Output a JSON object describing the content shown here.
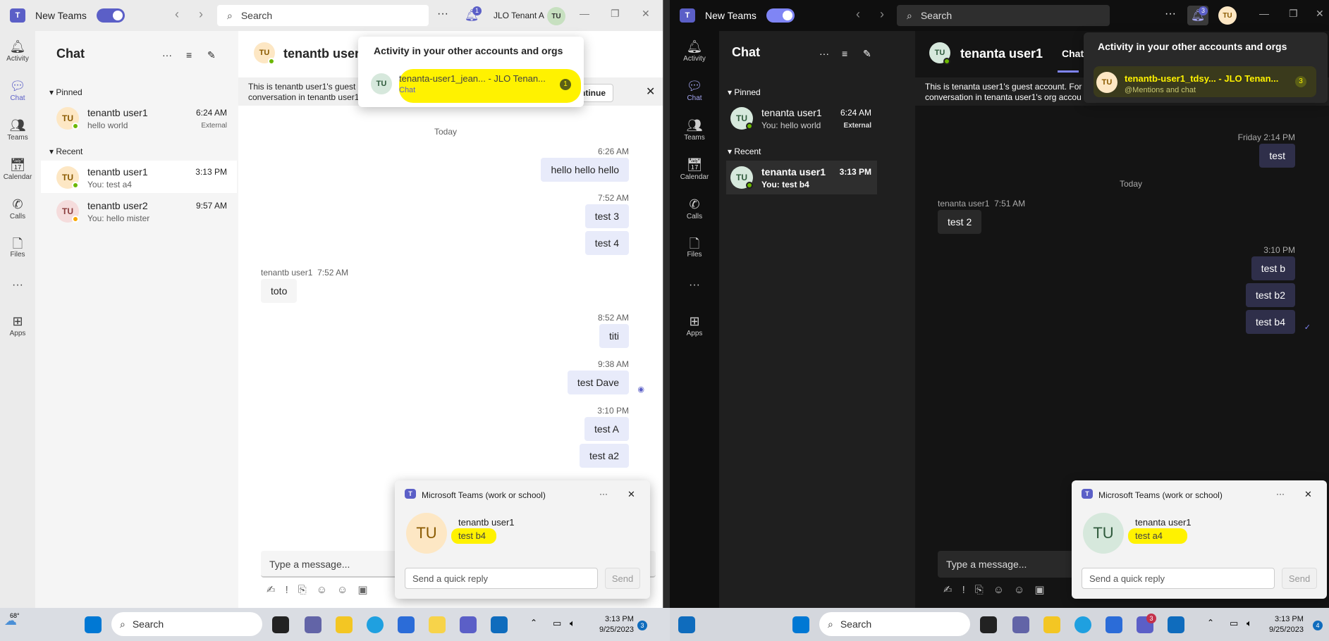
{
  "left": {
    "app_label": "New Teams",
    "search_placeholder": "Search",
    "notif_count": "1",
    "tenant": "JLO Tenant A",
    "avatar": "TU",
    "chat_title": "Chat",
    "pinned_label": "Pinned",
    "recent_label": "Recent",
    "pinned": [
      {
        "initials": "TU",
        "name": "tenantb user1",
        "preview": "hello world",
        "time": "6:24 AM",
        "tag": "External"
      }
    ],
    "recent": [
      {
        "initials": "TU",
        "name": "tenantb user1",
        "preview": "You: test a4",
        "time": "3:13 PM"
      },
      {
        "initials": "TU",
        "name": "tenantb user2",
        "preview": "You: hello mister",
        "time": "9:57 AM"
      }
    ],
    "conv_name": "tenantb user1",
    "banner_line1": "This is tenantb user1's guest",
    "banner_line2": "conversation in tenantb user1",
    "continue_label": "Continue",
    "day": "Today",
    "messages": [
      {
        "time": "6:26 AM",
        "text": "hello hello hello"
      },
      {
        "time": "7:52 AM",
        "text": "test 3"
      },
      {
        "text": "test 4"
      },
      {
        "sender": "tenantb user1",
        "time": "7:52 AM",
        "text": "toto"
      },
      {
        "time": "8:52 AM",
        "text": "titi"
      },
      {
        "time": "9:38 AM",
        "text": "test Dave"
      },
      {
        "time": "3:10 PM",
        "text": "test A"
      },
      {
        "text": "test a2"
      }
    ],
    "composer_placeholder": "Type a message...",
    "activity_title": "Activity in your other accounts and orgs",
    "activity_item": {
      "initials": "TU",
      "title": "tenanta-user1_jean... - JLO Tenan...",
      "sub": "Chat",
      "count": "1"
    },
    "toast": {
      "app": "Microsoft Teams (work or school)",
      "initials": "TU",
      "name": "tenantb user1",
      "message": "test b4",
      "reply_placeholder": "Send a quick reply",
      "send": "Send"
    }
  },
  "right": {
    "app_label": "New Teams",
    "search_placeholder": "Search",
    "notif_count": "3",
    "avatar": "TU",
    "chat_title": "Chat",
    "pinned_label": "Pinned",
    "recent_label": "Recent",
    "pinned": [
      {
        "initials": "TU",
        "name": "tenanta user1",
        "preview": "You: hello world",
        "time": "6:24 AM",
        "tag": "External"
      }
    ],
    "recent": [
      {
        "initials": "TU",
        "name": "tenanta user1",
        "preview": "You: test b4",
        "time": "3:13 PM"
      }
    ],
    "conv_name": "tenanta user1",
    "conv_tab": "Chat",
    "banner_line1": "This is tenanta user1's guest account. For",
    "banner_line2": "conversation in tenanta user1's org accou",
    "day": "Today",
    "messages": [
      {
        "time": "Friday 2:14 PM",
        "text": "test"
      },
      {
        "sender": "tenanta user1",
        "time": "7:51 AM",
        "text": "test 2"
      },
      {
        "time": "3:10 PM",
        "text": "test b"
      },
      {
        "text": "test b2"
      },
      {
        "text": "test b4"
      }
    ],
    "composer_placeholder": "Type a message...",
    "activity_title": "Activity in your other accounts and orgs",
    "activity_item": {
      "initials": "TU",
      "title": "tenantb-user1_tdsy... - JLO Tenan...",
      "sub": "@Mentions and chat",
      "count": "3"
    },
    "toast": {
      "app": "Microsoft Teams (work or school)",
      "initials": "TU",
      "name": "tenanta user1",
      "message": "test a4",
      "reply_placeholder": "Send a quick reply",
      "send": "Send"
    }
  },
  "rail": [
    "Activity",
    "Chat",
    "Teams",
    "Calendar",
    "Calls",
    "Files",
    "Apps"
  ],
  "taskbar": {
    "weather": "68°",
    "search": "Search",
    "left_time": "3:13 PM",
    "left_date": "9/25/2023",
    "left_badge": "3",
    "right_time": "3:13 PM",
    "right_date": "9/25/2023",
    "right_badge": "4",
    "teams_badge": "3"
  },
  "colors": {
    "accent": "#5b5fc7",
    "highlight": "#fff200",
    "available": "#6bb700",
    "away": "#f8a800"
  }
}
